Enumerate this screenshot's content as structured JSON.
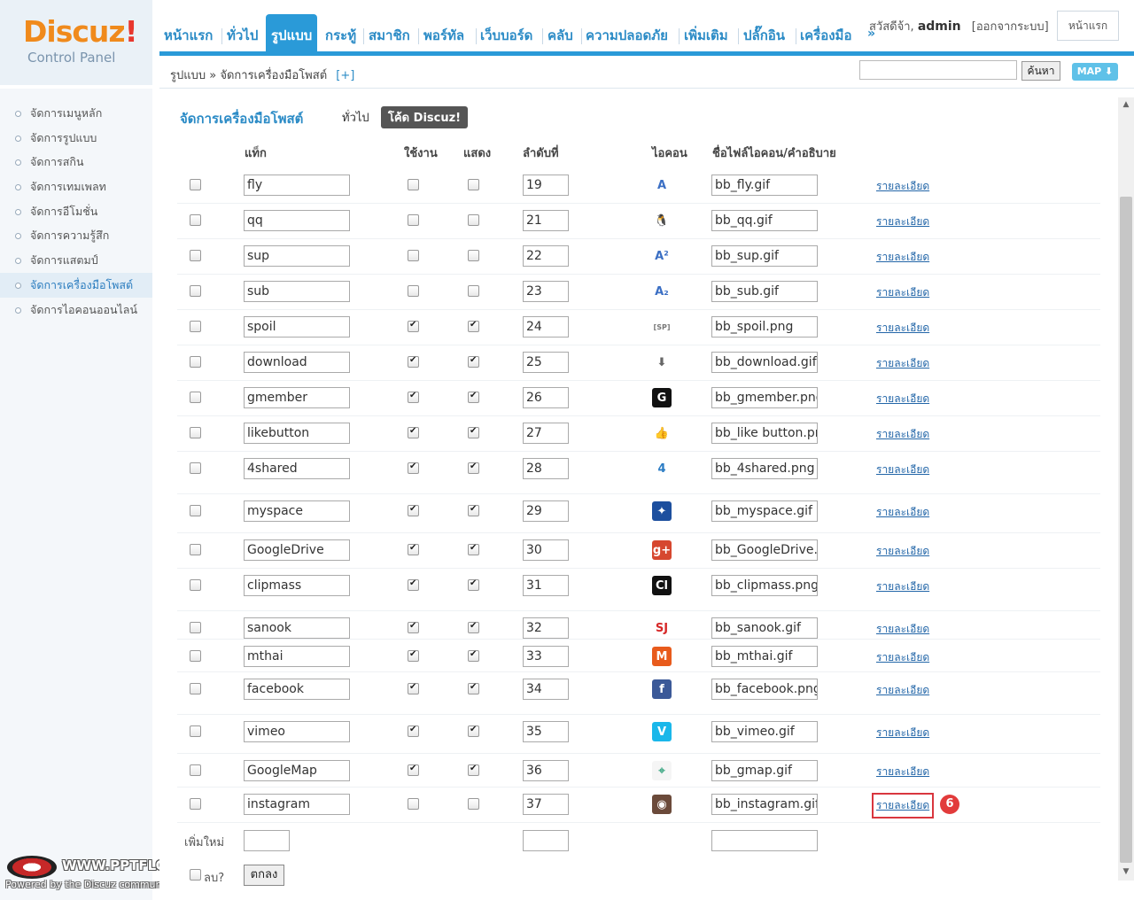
{
  "logo": {
    "main": "Discuz",
    "exclaim": "!",
    "sub": "Control Panel"
  },
  "nav": {
    "items": [
      "หน้าแรก",
      "ทั่วไป",
      "รูปแบบ",
      "กระทู้",
      "สมาชิก",
      "พอร์ทัล",
      "เว็บบอร์ด",
      "คลับ",
      "ความปลอดภัย",
      "เพิ่มเติม",
      "ปลั๊กอิน",
      "เครื่องมือ"
    ],
    "more": "»"
  },
  "user": {
    "greeting": "สวัสดีจ้า,",
    "name": "admin",
    "logout": "[ออกจากระบบ]",
    "home_button": "หน้าแรก"
  },
  "breadcrumb": {
    "text": "รูปแบบ » จัดการเครื่องมือโพสต์",
    "plus": "[+]"
  },
  "search": {
    "button": "ค้นหา",
    "map": "MAP ⬇"
  },
  "sidebar": {
    "items": [
      "จัดการเมนูหลัก",
      "จัดการรูปแบบ",
      "จัดการสกิน",
      "จัดการเทมเพลท",
      "จัดการอีโมชั่น",
      "จัดการความรู้สึก",
      "จัดการแสตมป์",
      "จัดการเครื่องมือโพสต์",
      "จัดการไอคอนออนไลน์"
    ]
  },
  "watermark": {
    "text": "WWW.PPTFLOWER.COM",
    "sub": "Powered by the Discuz community"
  },
  "page": {
    "title": "จัดการเครื่องมือโพสต์",
    "tab_general": "ทั่วไป",
    "tab_code": "โค้ด Discuz!"
  },
  "columns": {
    "tag": "แท็ก",
    "enabled": "ใช้งาน",
    "show": "แสดง",
    "order": "ลำดับที่",
    "icon": "ไอคอน",
    "file": "ชื่อไฟล์ไอคอน/คำอธิบาย"
  },
  "detail_label": "รายละเอียด",
  "rows": [
    {
      "tag": "fly",
      "enabled": false,
      "show": false,
      "order": "19",
      "file": "bb_fly.gif",
      "icon": "fly-icon"
    },
    {
      "tag": "qq",
      "enabled": false,
      "show": false,
      "order": "21",
      "file": "bb_qq.gif",
      "icon": "qq-icon"
    },
    {
      "tag": "sup",
      "enabled": false,
      "show": false,
      "order": "22",
      "file": "bb_sup.gif",
      "icon": "superscript-icon"
    },
    {
      "tag": "sub",
      "enabled": false,
      "show": false,
      "order": "23",
      "file": "bb_sub.gif",
      "icon": "subscript-icon"
    },
    {
      "tag": "spoil",
      "enabled": true,
      "show": true,
      "order": "24",
      "file": "bb_spoil.png",
      "icon": "spoil-icon"
    },
    {
      "tag": "download",
      "enabled": true,
      "show": true,
      "order": "25",
      "file": "bb_download.gif",
      "icon": "download-icon"
    },
    {
      "tag": "gmember",
      "enabled": true,
      "show": true,
      "order": "26",
      "file": "bb_gmember.png",
      "icon": "gmember-icon"
    },
    {
      "tag": "likebutton",
      "enabled": true,
      "show": true,
      "order": "27",
      "file": "bb_like button.png",
      "icon": "thumbs-up-icon"
    },
    {
      "tag": "4shared",
      "enabled": true,
      "show": true,
      "order": "28",
      "file": "bb_4shared.png",
      "icon": "4shared-icon"
    },
    {
      "tag": "myspace",
      "enabled": true,
      "show": true,
      "order": "29",
      "file": "bb_myspace.gif",
      "icon": "myspace-icon"
    },
    {
      "tag": "GoogleDrive",
      "enabled": true,
      "show": true,
      "order": "30",
      "file": "bb_GoogleDrive.",
      "icon": "google-plus-icon"
    },
    {
      "tag": "clipmass",
      "enabled": true,
      "show": true,
      "order": "31",
      "file": "bb_clipmass.png",
      "icon": "clipmass-icon"
    },
    {
      "tag": "sanook",
      "enabled": true,
      "show": true,
      "order": "32",
      "file": "bb_sanook.gif",
      "icon": "sanook-icon"
    },
    {
      "tag": "mthai",
      "enabled": true,
      "show": true,
      "order": "33",
      "file": "bb_mthai.gif",
      "icon": "mthai-icon"
    },
    {
      "tag": "facebook",
      "enabled": true,
      "show": true,
      "order": "34",
      "file": "bb_facebook.png",
      "icon": "facebook-icon"
    },
    {
      "tag": "vimeo",
      "enabled": true,
      "show": true,
      "order": "35",
      "file": "bb_vimeo.gif",
      "icon": "vimeo-icon"
    },
    {
      "tag": "GoogleMap",
      "enabled": true,
      "show": true,
      "order": "36",
      "file": "bb_gmap.gif",
      "icon": "google-map-icon"
    },
    {
      "tag": "instagram",
      "enabled": false,
      "show": false,
      "order": "37",
      "file": "bb_instagram.gif",
      "icon": "instagram-icon",
      "highlight": true,
      "step": "6"
    }
  ],
  "footer": {
    "add_new": "เพิ่มใหม่",
    "delete": "ลบ?",
    "submit": "ตกลง"
  },
  "colors": {
    "accent": "#2a9ad8",
    "link": "#2366a8",
    "highlight": "#e23b3b"
  }
}
